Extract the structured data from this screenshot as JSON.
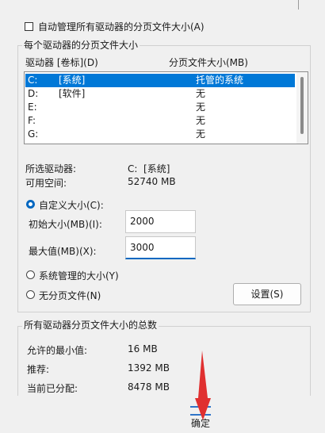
{
  "auto_manage": {
    "label": "自动管理所有驱动器的分页文件大小(A)",
    "checked": false
  },
  "per_drive": {
    "title": "每个驱动器的分页文件大小",
    "columns": [
      "驱动器 [卷标](D)",
      "分页文件大小(MB)"
    ],
    "rows": [
      {
        "drive": "C:",
        "label": "[系统]",
        "size": "托管的系统",
        "selected": true
      },
      {
        "drive": "D:",
        "label": "[软件]",
        "size": "无"
      },
      {
        "drive": "E:",
        "label": "",
        "size": "无"
      },
      {
        "drive": "F:",
        "label": "",
        "size": "无"
      },
      {
        "drive": "G:",
        "label": "",
        "size": "无"
      }
    ],
    "selected_drive_label": "所选驱动器:",
    "selected_drive_value": "C:  [系统]",
    "free_space_label": "可用空间:",
    "free_space_value": "52740 MB",
    "custom_size": {
      "label": "自定义大小(C):",
      "selected": true
    },
    "initial_size_label": "初始大小(MB)(I):",
    "initial_size_value": "2000",
    "max_size_label": "最大值(MB)(X):",
    "max_size_value": "3000",
    "system_managed": {
      "label": "系统管理的大小(Y)",
      "selected": false
    },
    "no_paging": {
      "label": "无分页文件(N)",
      "selected": false
    },
    "set_button": "设置(S)"
  },
  "totals": {
    "title": "所有驱动器分页文件大小的总数",
    "min_label": "允许的最小值:",
    "min_value": "16 MB",
    "recommended_label": "推荐:",
    "recommended_value": "1392 MB",
    "allocated_label": "当前已分配:",
    "allocated_value": "8478 MB"
  },
  "ok_button": "确定",
  "colors": {
    "selection": "#0078d7",
    "accent": "#0067c0",
    "arrow": "#e03030"
  }
}
